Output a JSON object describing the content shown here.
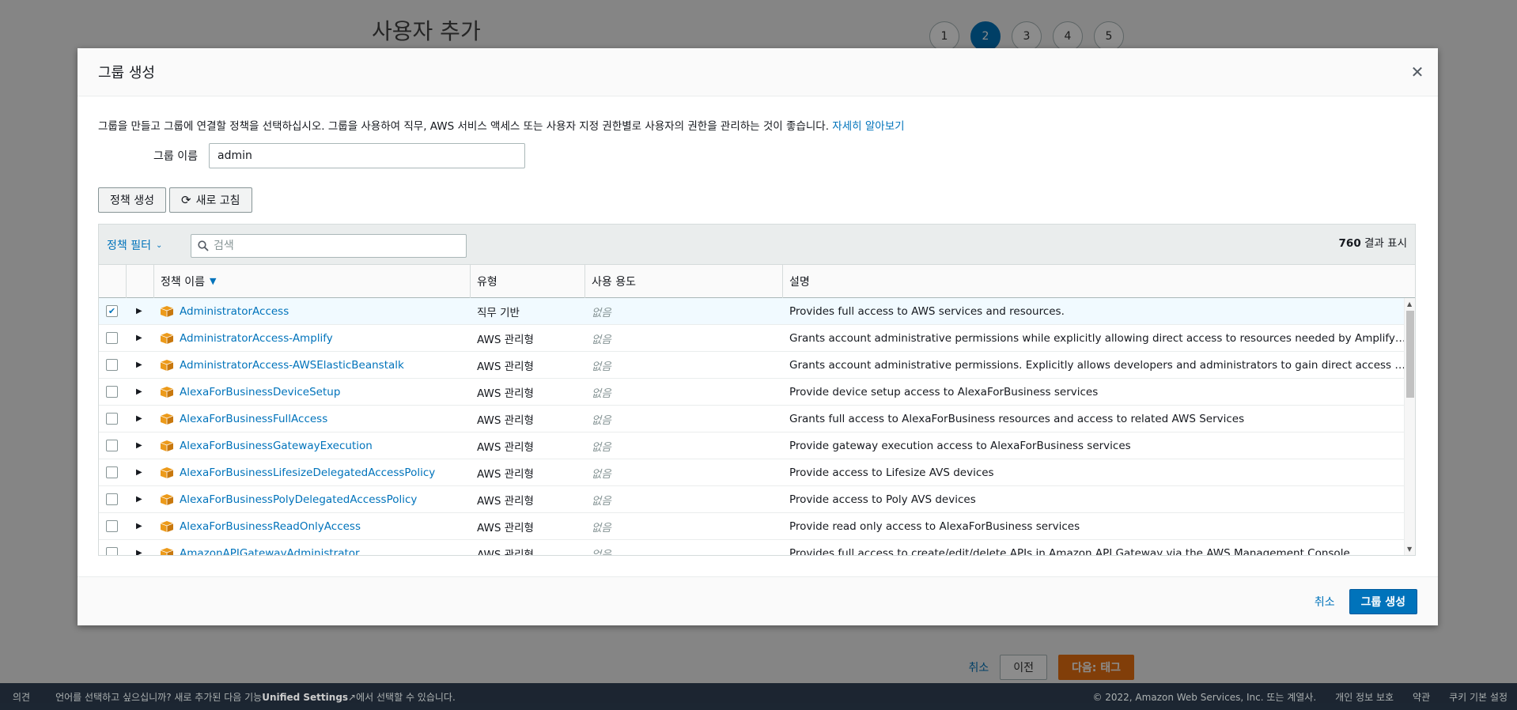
{
  "background": {
    "page_title": "사용자 추가",
    "steps": [
      "1",
      "2",
      "3",
      "4",
      "5"
    ],
    "active_step": "2",
    "actions": {
      "cancel": "취소",
      "previous": "이전",
      "next": "다음: 태그"
    }
  },
  "footer": {
    "feedback": "의견",
    "language_prompt_prefix": "언어를 선택하고 싶으십니까? 새로 추가된 다음 기능",
    "language_prompt_link": "Unified Settings",
    "language_prompt_suffix": "에서 선택할 수 있습니다.",
    "copyright": "© 2022, Amazon Web Services, Inc. 또는 계열사.",
    "privacy": "개인 정보 보호",
    "terms": "약관",
    "cookie": "쿠키 기본 설정"
  },
  "modal": {
    "title": "그룹 생성",
    "intro": "그룹을 만들고 그룹에 연결할 정책을 선택하십시오. 그룹을 사용하여 직무, AWS 서비스 액세스 또는 사용자 지정 권한별로 사용자의 권한을 관리하는 것이 좋습니다.",
    "learn_more": "자세히 알아보기",
    "group_name_label": "그룹 이름",
    "group_name_value": "admin",
    "create_policy_btn": "정책 생성",
    "refresh_btn": "새로 고침",
    "filter_label": "정책 필터",
    "search_placeholder": "검색",
    "result_count_num": "760",
    "result_count_suffix": "결과 표시",
    "columns": {
      "name": "정책 이름",
      "type": "유형",
      "use": "사용 용도",
      "desc": "설명"
    },
    "rows": [
      {
        "name": "AdministratorAccess",
        "type": "직무 기반",
        "use": "없음",
        "desc": "Provides full access to AWS services and resources.",
        "checked": true
      },
      {
        "name": "AdministratorAccess-Amplify",
        "type": "AWS 관리형",
        "use": "없음",
        "desc": "Grants account administrative permissions while explicitly allowing direct access to resources needed by Amplify applicat...",
        "checked": false
      },
      {
        "name": "AdministratorAccess-AWSElasticBeanstalk",
        "type": "AWS 관리형",
        "use": "없음",
        "desc": "Grants account administrative permissions. Explicitly allows developers and administrators to gain direct access to resou...",
        "checked": false
      },
      {
        "name": "AlexaForBusinessDeviceSetup",
        "type": "AWS 관리형",
        "use": "없음",
        "desc": "Provide device setup access to AlexaForBusiness services",
        "checked": false
      },
      {
        "name": "AlexaForBusinessFullAccess",
        "type": "AWS 관리형",
        "use": "없음",
        "desc": "Grants full access to AlexaForBusiness resources and access to related AWS Services",
        "checked": false
      },
      {
        "name": "AlexaForBusinessGatewayExecution",
        "type": "AWS 관리형",
        "use": "없음",
        "desc": "Provide gateway execution access to AlexaForBusiness services",
        "checked": false
      },
      {
        "name": "AlexaForBusinessLifesizeDelegatedAccessPolicy",
        "type": "AWS 관리형",
        "use": "없음",
        "desc": "Provide access to Lifesize AVS devices",
        "checked": false
      },
      {
        "name": "AlexaForBusinessPolyDelegatedAccessPolicy",
        "type": "AWS 관리형",
        "use": "없음",
        "desc": "Provide access to Poly AVS devices",
        "checked": false
      },
      {
        "name": "AlexaForBusinessReadOnlyAccess",
        "type": "AWS 관리형",
        "use": "없음",
        "desc": "Provide read only access to AlexaForBusiness services",
        "checked": false
      },
      {
        "name": "AmazonAPIGatewayAdministrator",
        "type": "AWS 관리형",
        "use": "없음",
        "desc": "Provides full access to create/edit/delete APIs in Amazon API Gateway via the AWS Management Console.",
        "checked": false
      }
    ],
    "cancel_btn": "취소",
    "create_group_btn": "그룹 생성"
  },
  "colors": {
    "link": "#0073bb",
    "primary": "#0073bb",
    "orange": "#ec7211",
    "policy_icon": "#ec9a1a"
  }
}
